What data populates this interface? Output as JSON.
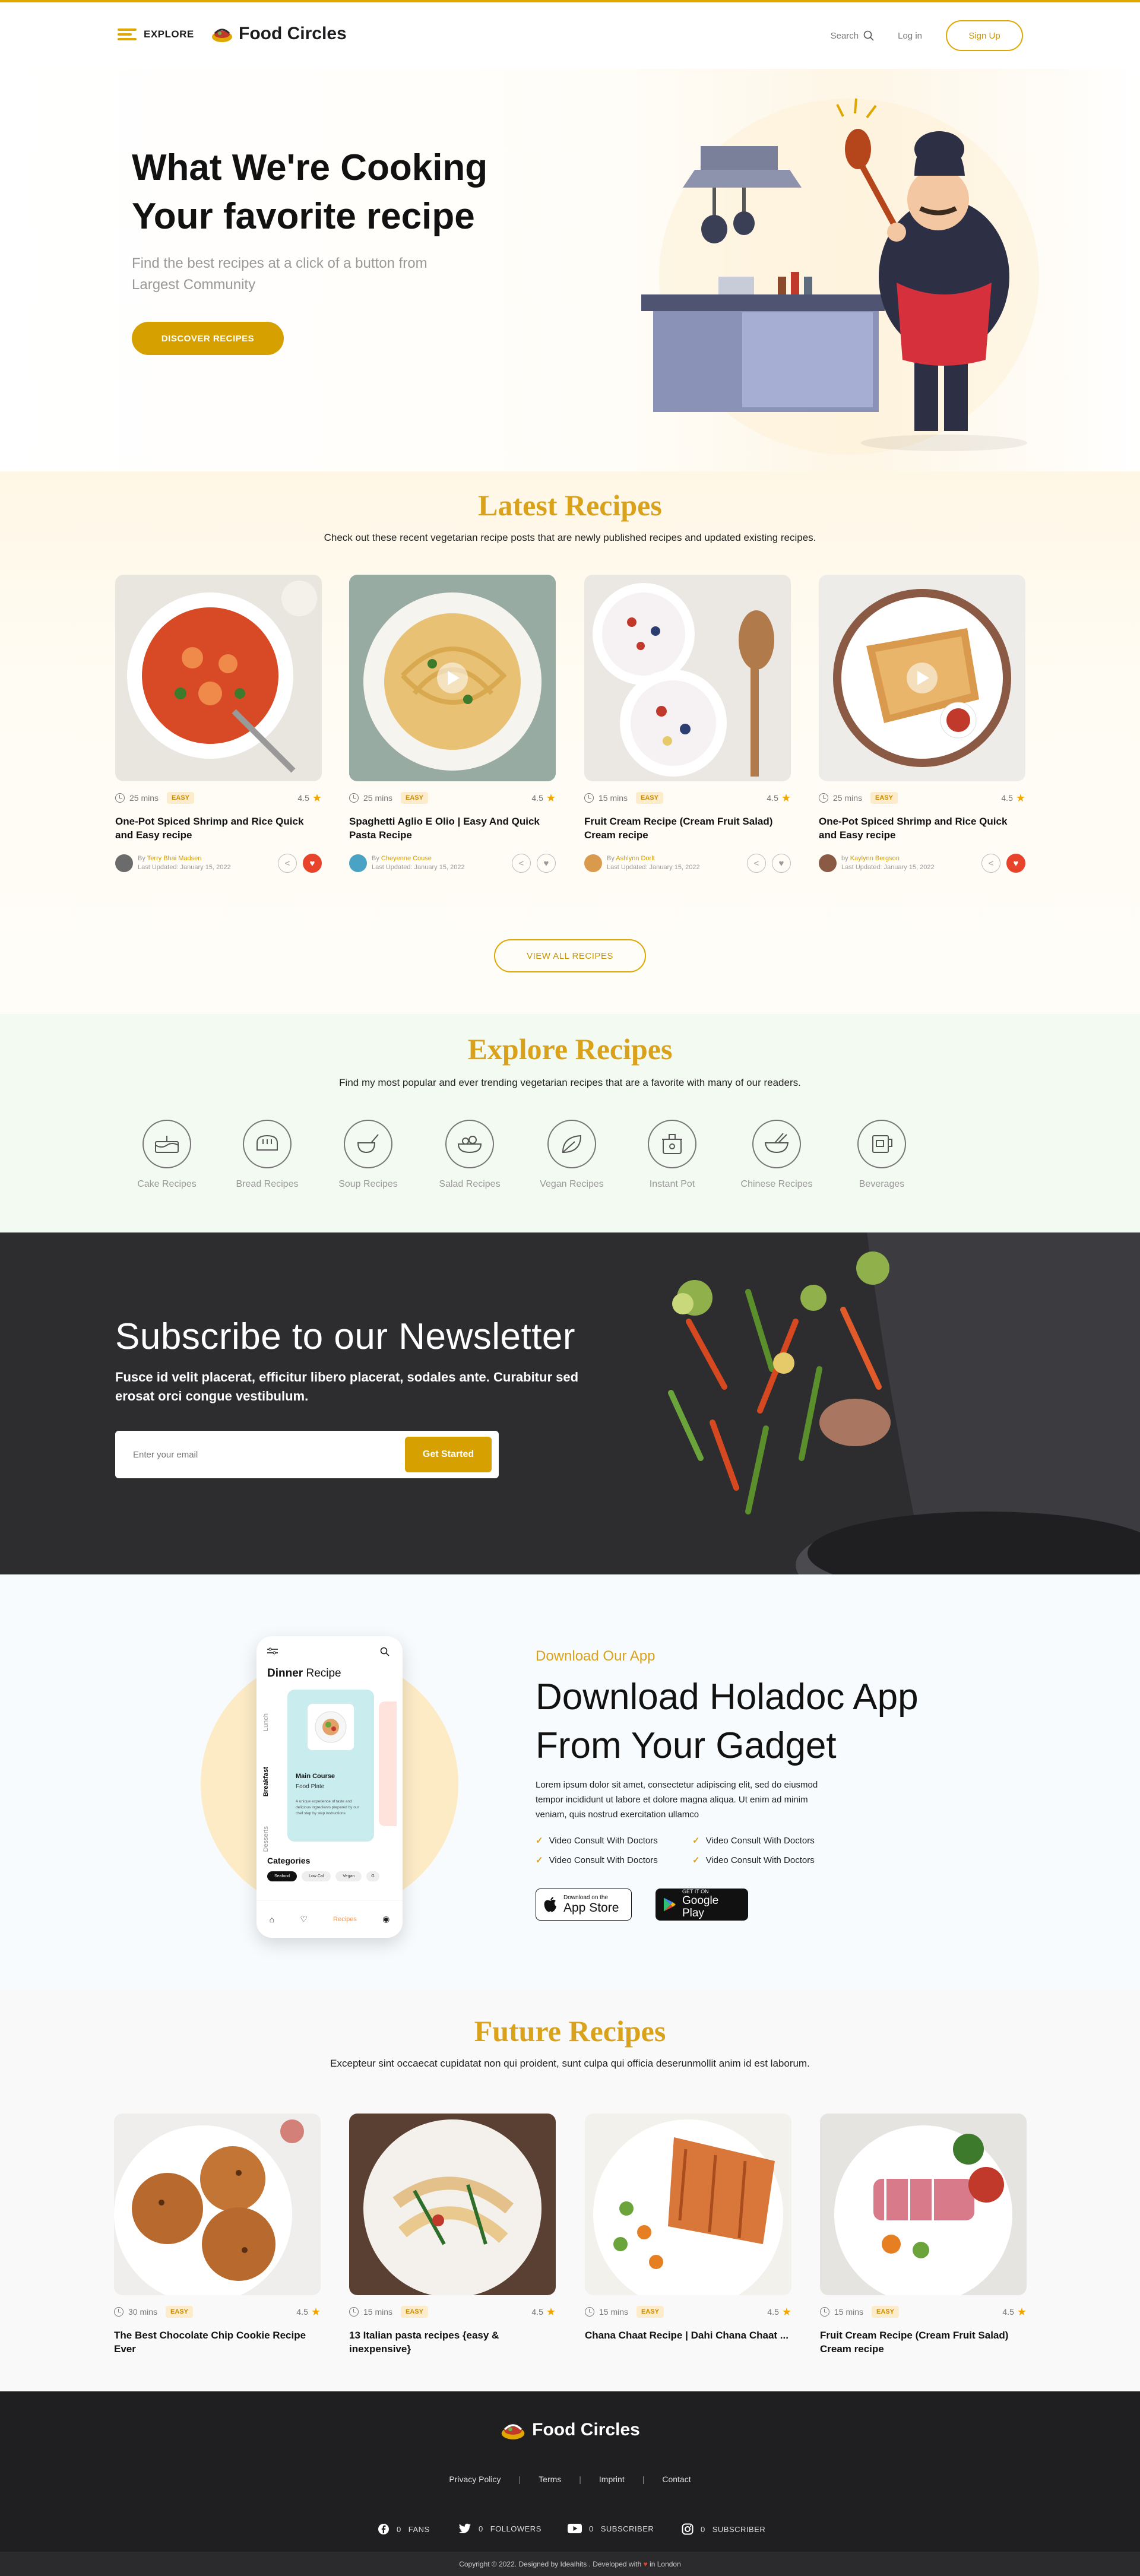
{
  "header": {
    "explore_label": "EXPLORE",
    "brand": "Food Circles",
    "search_label": "Search",
    "login_label": "Log in",
    "signup_label": "Sign Up"
  },
  "hero": {
    "title_line1": "What We're Cooking",
    "title_line2": "Your favorite recipe",
    "subtitle": "Find the best recipes at a click of a button from Largest Community",
    "cta": "DISCOVER RECIPES"
  },
  "latest": {
    "title": "Latest Recipes",
    "subtitle": "Check out these recent vegetarian recipe posts that are newly published recipes and updated existing recipes.",
    "view_all": "VIEW ALL RECIPES",
    "cards": [
      {
        "time": "25 mins",
        "difficulty": "EASY",
        "rating": "4.5",
        "title": "One-Pot Spiced Shrimp and Rice Quick and Easy recipe",
        "by": "By",
        "author": "Terry Bhai Madsen",
        "updated": "Last Updated: January 15, 2022"
      },
      {
        "time": "25 mins",
        "difficulty": "EASY",
        "rating": "4.5",
        "title": "Spaghetti Aglio E Olio | Easy And Quick Pasta Recipe",
        "by": "By",
        "author": "Cheyenne Couse",
        "updated": "Last Updated: January 15, 2022"
      },
      {
        "time": "15 mins",
        "difficulty": "EASY",
        "rating": "4.5",
        "title": "Fruit Cream Recipe (Cream Fruit Salad) Cream recipe",
        "by": "By",
        "author": "Ashlynn Dorlt",
        "updated": "Last Updated: January 15, 2022"
      },
      {
        "time": "25 mins",
        "difficulty": "EASY",
        "rating": "4.5",
        "title": "One-Pot Spiced Shrimp and Rice Quick and Easy recipe",
        "by": "by",
        "author": "Kaylynn Bergson",
        "updated": "Last Updated: January 15, 2022"
      }
    ]
  },
  "explore": {
    "title": "Explore Recipes",
    "subtitle": "Find my most popular and ever trending vegetarian recipes that are a favorite with many of our readers.",
    "categories": [
      "Cake Recipes",
      "Bread Recipes",
      "Soup Recipes",
      "Salad Recipes",
      "Vegan Recipes",
      "Instant Pot",
      "Chinese Recipes",
      "Beverages"
    ]
  },
  "newsletter": {
    "title": "Subscribe to our Newsletter",
    "text": "Fusce id velit placerat, efficitur libero placerat, sodales ante. Curabitur sed erosat orci congue vestibulum.",
    "placeholder": "Enter your email",
    "button": "Get Started"
  },
  "app": {
    "pretitle": "Download Our App",
    "title_line1": "Download Holadoc App",
    "title_line2": "From Your Gadget",
    "text": "Lorem ipsum dolor sit amet, consectetur adipiscing elit, sed do eiusmod tempor incididunt ut labore et dolore magna aliqua. Ut enim ad minim veniam, quis nostrud exercitation ullamco",
    "features": [
      "Video Consult With Doctors",
      "Video Consult With Doctors",
      "Video Consult With Doctors",
      "Video Consult With Doctors"
    ],
    "appstore_small": "Download on the",
    "appstore_big": "App Store",
    "gplay_small": "GET IT ON",
    "gplay_big": "Google Play",
    "phone": {
      "heading_bold": "Dinner",
      "heading_rest": "Recipe",
      "side_tabs": [
        "Lunch",
        "Breakfast",
        "Desserts"
      ],
      "card_title": "Main Course",
      "card_sub": "Food Plate",
      "card_text": "A unique experience of taste and delicious ingredients prepared by our chef step by step instructions",
      "categories_label": "Categories",
      "chips": [
        "Seafood",
        "Low Cal",
        "Vegan",
        "G"
      ],
      "nav_active": "Recipes"
    }
  },
  "future": {
    "title": "Future Recipes",
    "subtitle": "Excepteur sint occaecat cupidatat non qui proident, sunt culpa qui officia deserunmollit anim id est laborum.",
    "cards": [
      {
        "time": "30 mins",
        "difficulty": "EASY",
        "rating": "4.5",
        "title": "The Best Chocolate Chip Cookie Recipe Ever"
      },
      {
        "time": "15 mins",
        "difficulty": "EASY",
        "rating": "4.5",
        "title": "13 Italian pasta recipes {easy & inexpensive}"
      },
      {
        "time": "15 mins",
        "difficulty": "EASY",
        "rating": "4.5",
        "title": "Chana Chaat Recipe | Dahi Chana Chaat ..."
      },
      {
        "time": "15 mins",
        "difficulty": "EASY",
        "rating": "4.5",
        "title": "Fruit Cream Recipe (Cream Fruit Salad) Cream recipe"
      }
    ]
  },
  "footer": {
    "brand": "Food Circles",
    "links": [
      "Privacy Policy",
      "Terms",
      "Imprint",
      "Contact"
    ],
    "social": [
      {
        "count": "0",
        "label": "FANS"
      },
      {
        "count": "0",
        "label": "FOLLOWERS"
      },
      {
        "count": "0",
        "label": "SUBSCRIBER"
      },
      {
        "count": "0",
        "label": "SUBSCRIBER"
      }
    ],
    "copyright_pre": "Copyright © 2022. Designed by Idealhits . Developed with",
    "copyright_post": "in London"
  },
  "colors": {
    "accent": "#d6a100",
    "title_gold": "#d9a21a",
    "dark": "#2d2d2f",
    "footer": "#1f1f21",
    "heart": "#e8442c"
  }
}
